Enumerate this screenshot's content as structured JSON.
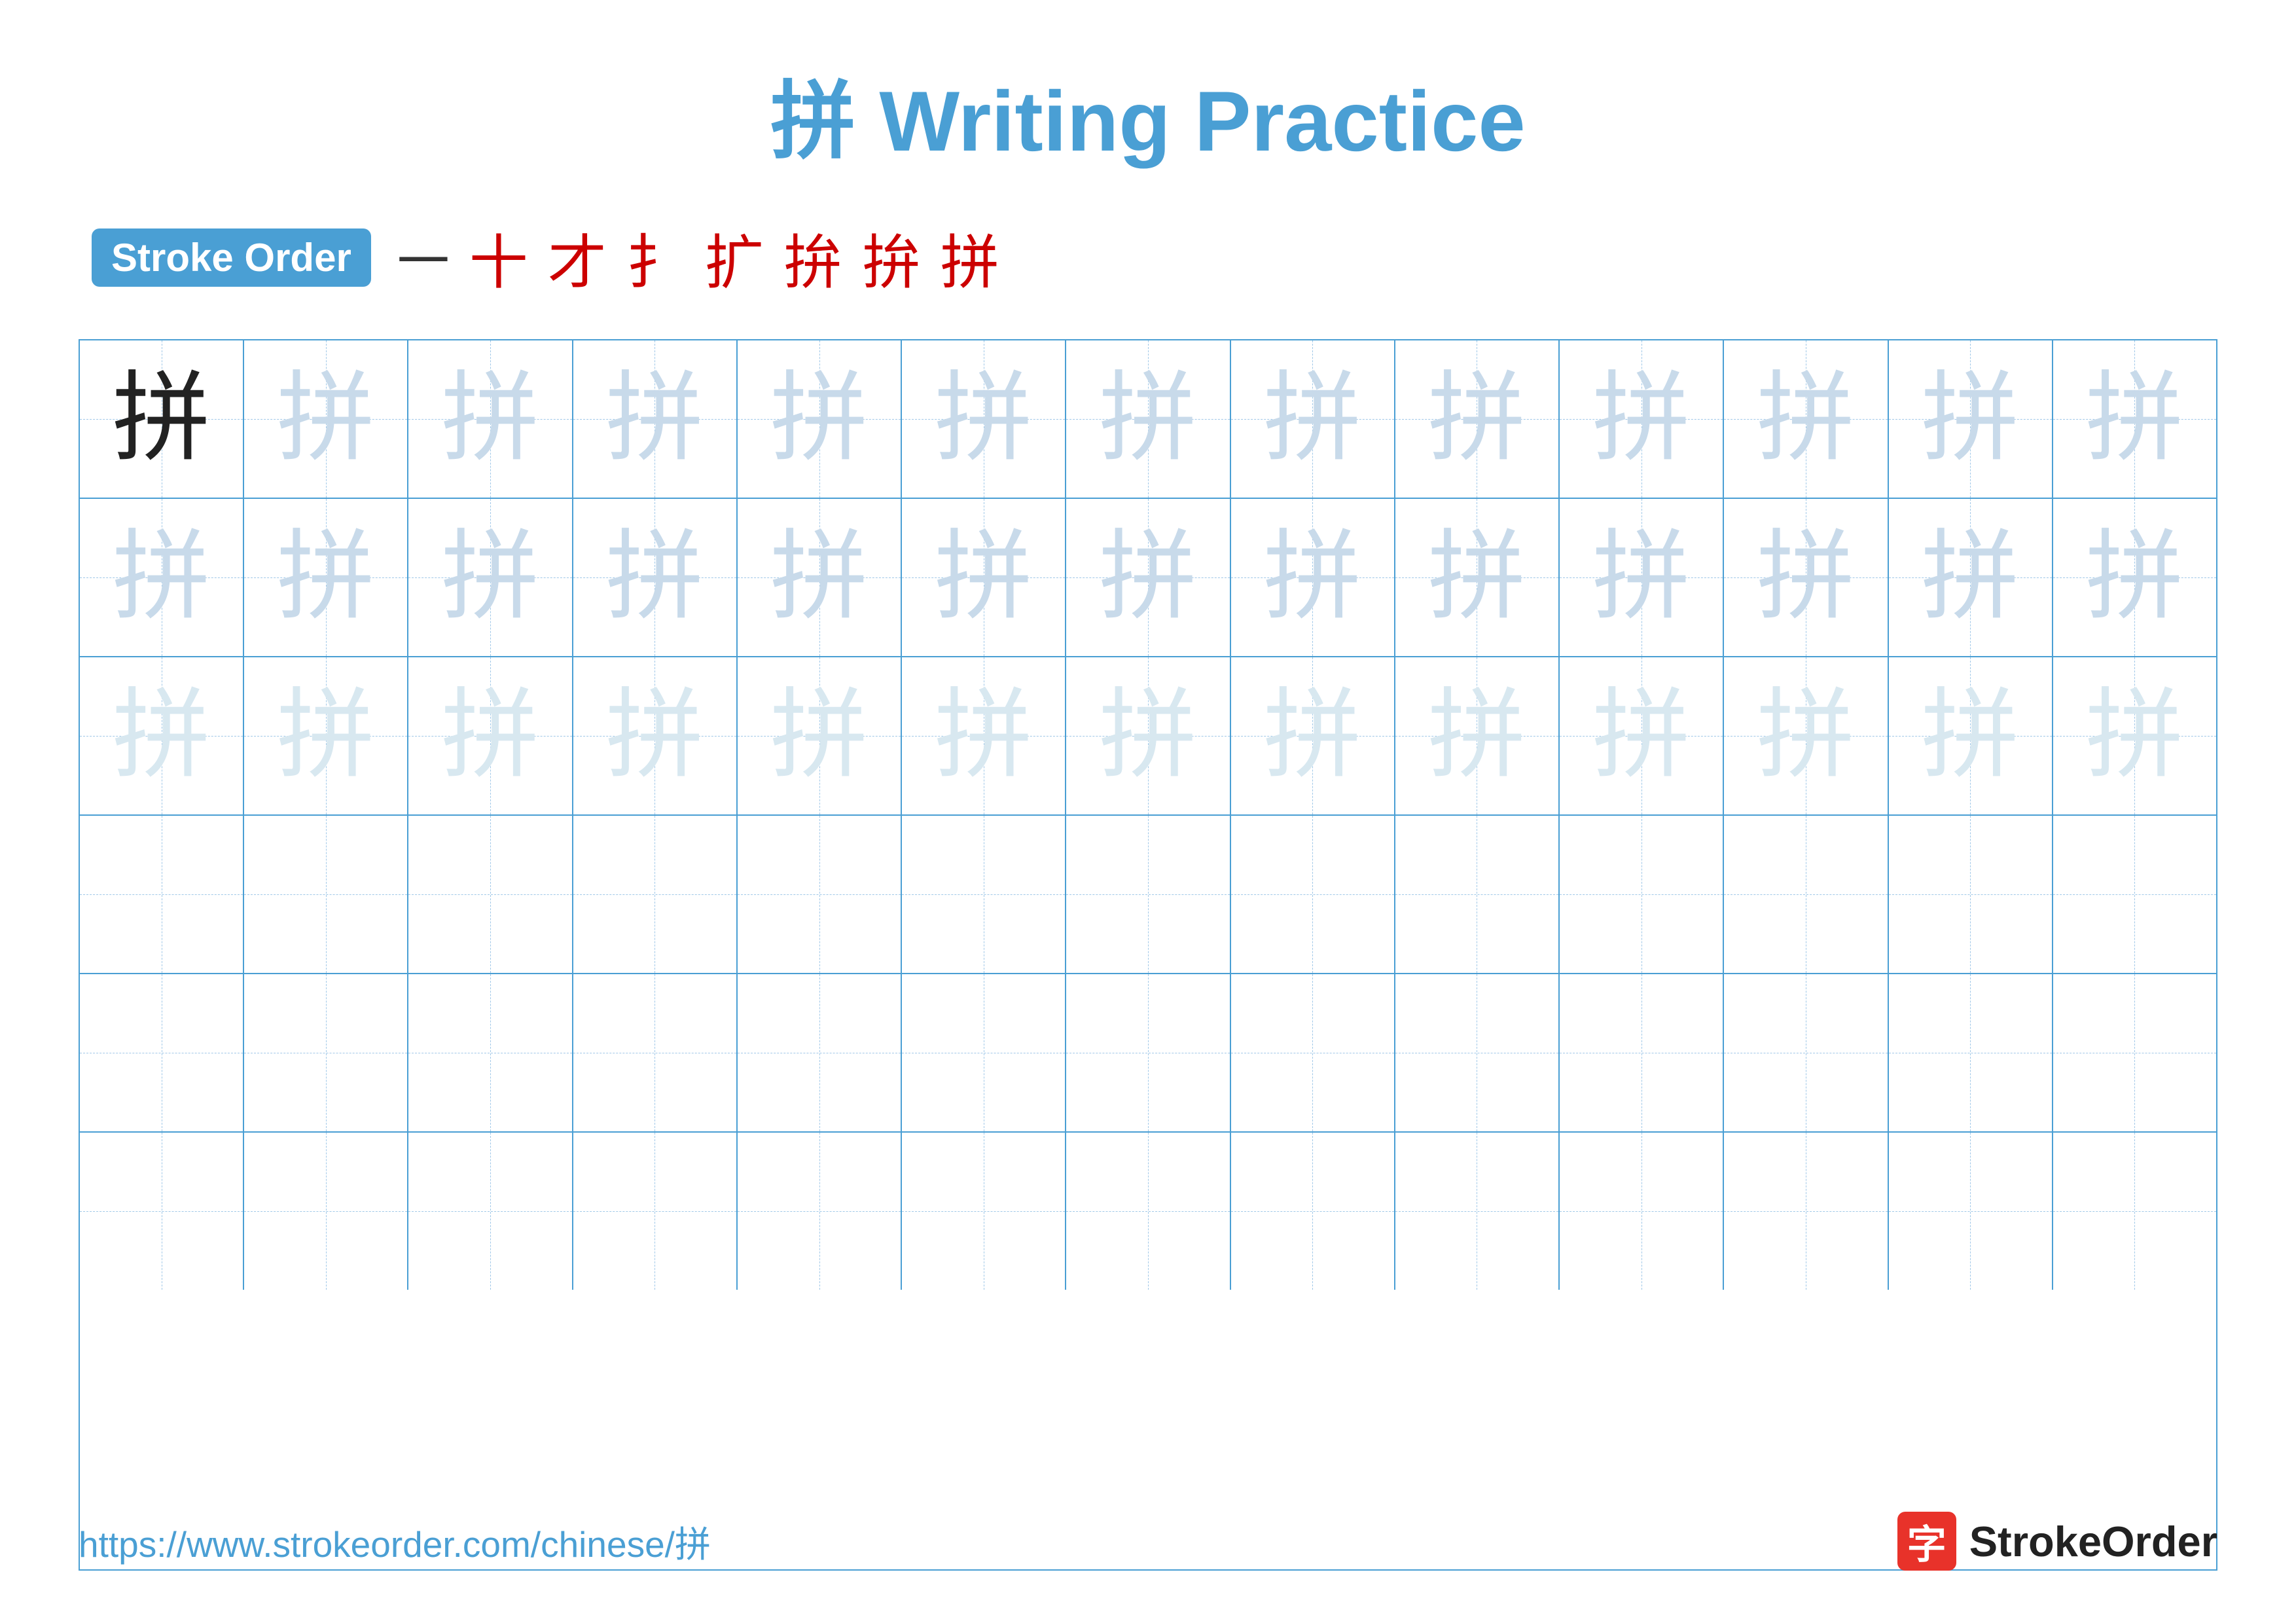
{
  "title": {
    "char": "拼",
    "text": "Writing Practice",
    "full": "拼 Writing Practice"
  },
  "stroke_order": {
    "badge_label": "Stroke Order",
    "dash": "一",
    "sequence": [
      "十",
      "才",
      "扌",
      "扩",
      "拚",
      "拚",
      "拼"
    ]
  },
  "grid": {
    "rows": 6,
    "cols": 13,
    "char": "拼",
    "row_types": [
      "dark_then_light",
      "light",
      "lighter",
      "empty",
      "empty",
      "empty"
    ]
  },
  "footer": {
    "url": "https://www.strokeorder.com/chinese/拼",
    "logo_char": "字",
    "logo_text": "StrokeOrder"
  }
}
